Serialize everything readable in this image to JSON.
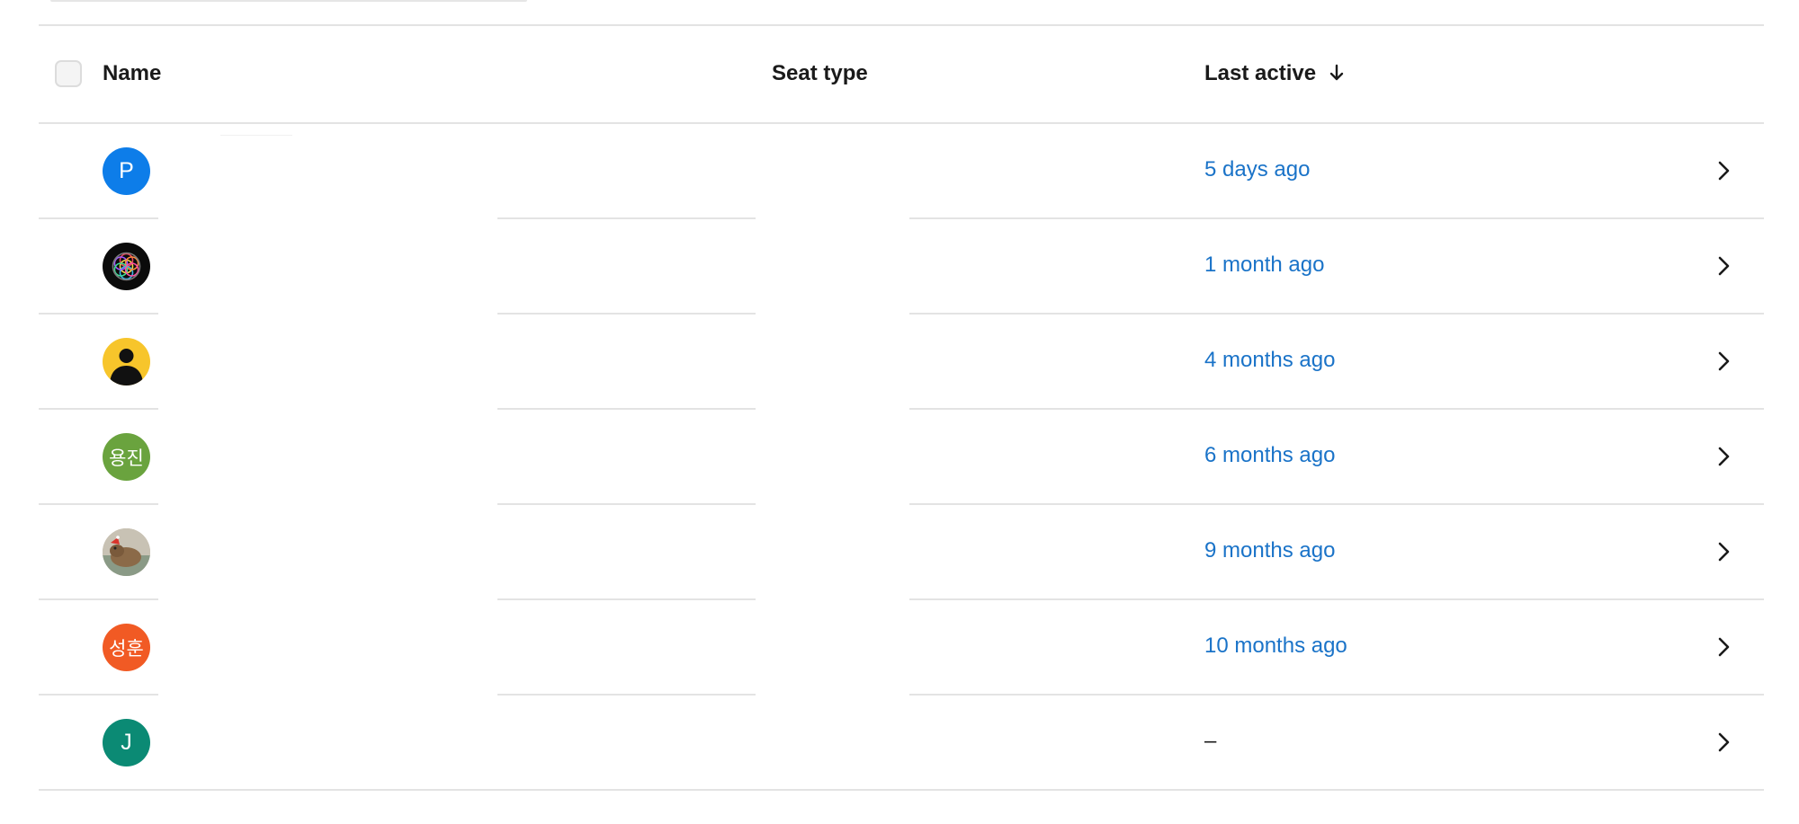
{
  "table": {
    "select_all_checked": false,
    "columns": {
      "name": "Name",
      "seat_type": "Seat type",
      "last_active": "Last active",
      "sort_icon": "arrow-down-icon"
    },
    "rows": [
      {
        "avatar_type": "initials",
        "avatar_text": "P",
        "avatar_color": "#0d7de9",
        "last_active": "5 days ago"
      },
      {
        "avatar_type": "image",
        "avatar_text": "",
        "avatar_description": "colorful-flower-of-life-on-black",
        "last_active": "1 month ago"
      },
      {
        "avatar_type": "default-person",
        "avatar_text": "",
        "avatar_color": "#f7c52b",
        "last_active": "4 months ago"
      },
      {
        "avatar_type": "initials",
        "avatar_text": "용진",
        "avatar_color": "#6aa33e",
        "last_active": "6 months ago"
      },
      {
        "avatar_type": "image",
        "avatar_text": "",
        "avatar_description": "photo-of-animal",
        "last_active": "9 months ago"
      },
      {
        "avatar_type": "initials",
        "avatar_text": "성훈",
        "avatar_color": "#f15a24",
        "last_active": "10 months ago"
      },
      {
        "avatar_type": "initials",
        "avatar_text": "J",
        "avatar_color": "#0b8a74",
        "last_active": "–"
      }
    ]
  },
  "colors": {
    "link_blue": "#1a73c8",
    "divider": "#e3e3e3",
    "text": "#1a1a1a"
  }
}
